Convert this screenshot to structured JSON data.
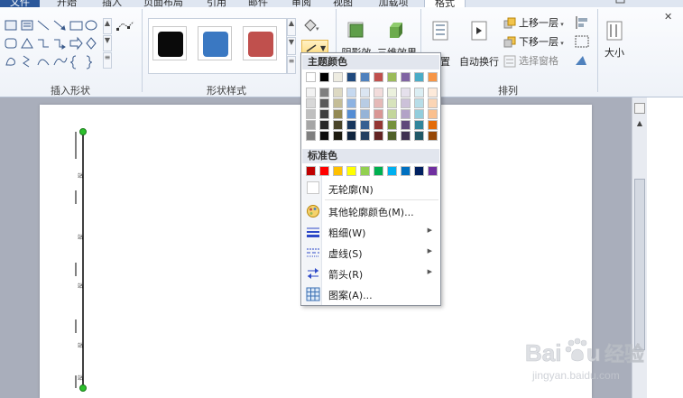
{
  "tabs": [
    {
      "label": "文件"
    },
    {
      "label": "开始"
    },
    {
      "label": "插入"
    },
    {
      "label": "页面布局"
    },
    {
      "label": "引用"
    },
    {
      "label": "邮件"
    },
    {
      "label": "审阅"
    },
    {
      "label": "视图"
    },
    {
      "label": "加载项"
    },
    {
      "label": "格式"
    }
  ],
  "ribbon": {
    "groups": {
      "insert_shapes": "插入形状",
      "shape_styles": "形状样式",
      "arrange": "排列"
    },
    "style_swatches": [
      {
        "color": "#0a0a0a"
      },
      {
        "color": "#3a78c2"
      },
      {
        "color": "#c0504d"
      }
    ],
    "shadow_effects": "阴影效果",
    "threed_effects": "三维效果",
    "position": "位置",
    "wrap_text": "自动换行",
    "bring_forward": "上移一层",
    "send_backward": "下移一层",
    "selection_pane": "选择窗格",
    "size": "大小"
  },
  "dropdown": {
    "theme_colors_header": "主题颜色",
    "standard_colors_header": "标准色",
    "theme_top_row": [
      "#ffffff",
      "#000000",
      "#eeece1",
      "#1f497d",
      "#4f81bd",
      "#c0504d",
      "#9bbb59",
      "#8064a2",
      "#4bacc6",
      "#f79646"
    ],
    "theme_shades": [
      [
        "#f2f2f2",
        "#7f7f7f",
        "#ddd9c3",
        "#c6d9f0",
        "#dbe5f1",
        "#f2dcdb",
        "#ebf1dd",
        "#e5e0ec",
        "#dbeef3",
        "#fdeada"
      ],
      [
        "#d8d8d8",
        "#595959",
        "#c4bd97",
        "#8db3e2",
        "#b8cce4",
        "#e5b9b7",
        "#d7e3bc",
        "#ccc1d9",
        "#b7dde8",
        "#fbd5b5"
      ],
      [
        "#bfbfbf",
        "#3f3f3f",
        "#938953",
        "#548dd4",
        "#95b3d7",
        "#d99694",
        "#c3d69b",
        "#b2a2c7",
        "#92cddc",
        "#fac08f"
      ],
      [
        "#a5a5a5",
        "#262626",
        "#494429",
        "#17365d",
        "#366092",
        "#953734",
        "#76923c",
        "#5f497a",
        "#31859b",
        "#e36c09"
      ],
      [
        "#7f7f7f",
        "#0c0c0c",
        "#1d1b10",
        "#0f243e",
        "#244061",
        "#632423",
        "#4f6128",
        "#3f3151",
        "#205867",
        "#974806"
      ]
    ],
    "standard_colors": [
      "#c00000",
      "#ff0000",
      "#ffc000",
      "#ffff00",
      "#92d050",
      "#00b050",
      "#00b0f0",
      "#0070c0",
      "#002060",
      "#7030a0"
    ],
    "no_outline": "无轮廓(N)",
    "more_colors": "其他轮廓颜色(M)...",
    "weight": "粗细(W)",
    "dashes": "虚线(S)",
    "arrows": "箭头(R)",
    "pattern": "图案(A)..."
  },
  "document": {
    "line_labels": [
      "站",
      "站",
      "站",
      "站",
      "站"
    ]
  },
  "watermark": {
    "brand": "Baidu",
    "brand_cn": "经验",
    "url": "jingyan.baidu.com"
  }
}
